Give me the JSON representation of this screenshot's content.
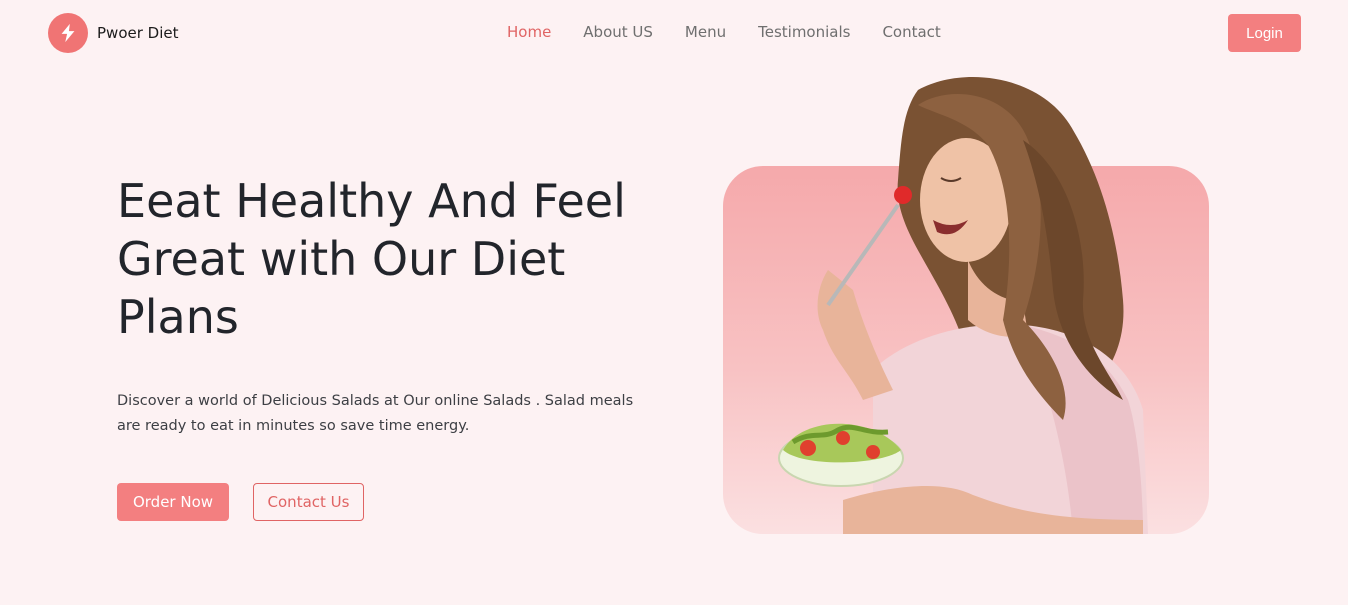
{
  "brand": {
    "name": "Pwoer Diet",
    "icon": "lightning-bolt-icon",
    "accent": "#f37f80"
  },
  "nav": {
    "items": [
      {
        "label": "Home",
        "active": true
      },
      {
        "label": "About US",
        "active": false
      },
      {
        "label": "Menu",
        "active": false
      },
      {
        "label": "Testimonials",
        "active": false
      },
      {
        "label": "Contact",
        "active": false
      }
    ],
    "login_label": "Login"
  },
  "hero": {
    "title": "Eeat Healthy And Feel Great with Our Diet Plans",
    "description": "Discover a world of Delicious Salads at Our online Salads . Salad meals are ready to eat in minutes so save time energy.",
    "primary_button": "Order Now",
    "secondary_button": "Contact Us",
    "image": "woman-eating-salad-photo"
  },
  "colors": {
    "background": "#fdf2f3",
    "primary": "#f37f80",
    "nav_active": "#e06464",
    "text": "#22252b"
  }
}
